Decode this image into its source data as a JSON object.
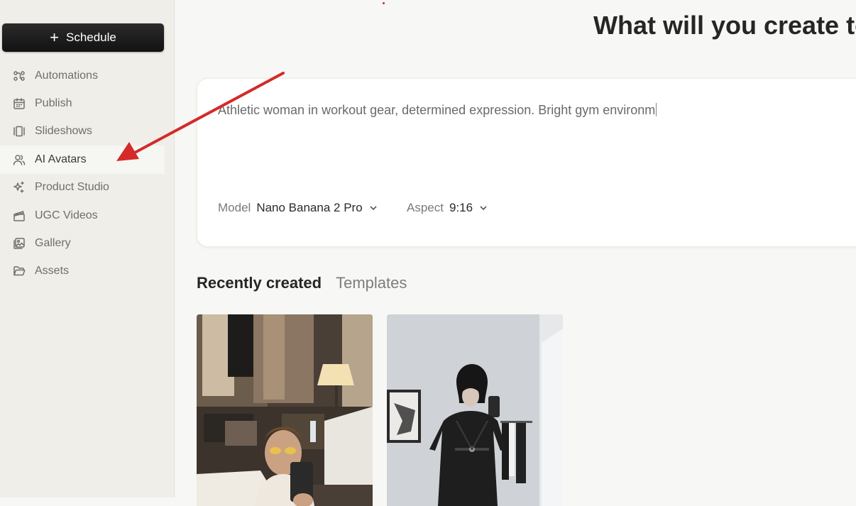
{
  "sidebar": {
    "schedule_label": "Schedule",
    "items": [
      {
        "label": "Automations",
        "icon": "automations-icon"
      },
      {
        "label": "Publish",
        "icon": "calendar-icon"
      },
      {
        "label": "Slideshows",
        "icon": "slideshows-icon"
      },
      {
        "label": "AI Avatars",
        "icon": "users-icon",
        "active": true
      },
      {
        "label": "Product Studio",
        "icon": "sparkles-icon"
      },
      {
        "label": "UGC Videos",
        "icon": "clapperboard-icon"
      },
      {
        "label": "Gallery",
        "icon": "image-icon"
      },
      {
        "label": "Assets",
        "icon": "folder-icon"
      }
    ]
  },
  "main": {
    "title": "What will you create to",
    "prompt": {
      "value": "Athletic woman in workout gear, determined expression. Bright gym environm",
      "model_label": "Model",
      "model_value": "Nano Banana 2 Pro",
      "aspect_label": "Aspect",
      "aspect_value": "9:16"
    },
    "tabs": [
      {
        "label": "Recently created",
        "active": true
      },
      {
        "label": "Templates",
        "active": false
      }
    ]
  },
  "colors": {
    "sidebar_bg": "#efeee9",
    "page_bg": "#f7f7f5",
    "annotation_arrow": "#d42a2a"
  }
}
